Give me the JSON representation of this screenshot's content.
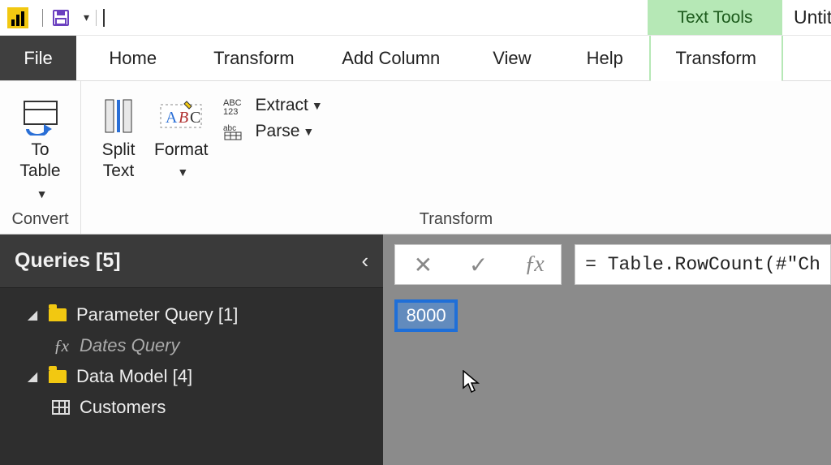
{
  "titlebar": {
    "context_tool_label": "Text Tools",
    "document_title": "Untit"
  },
  "tabs": {
    "file": "File",
    "home": "Home",
    "transform": "Transform",
    "add_column": "Add Column",
    "view": "View",
    "help": "Help",
    "context_transform": "Transform"
  },
  "ribbon": {
    "convert": {
      "to_table_line1": "To",
      "to_table_line2": "Table",
      "group_label": "Convert"
    },
    "transform": {
      "split_text_line1": "Split",
      "split_text_line2": "Text",
      "format_line1": "Format",
      "extract_label": "Extract",
      "parse_label": "Parse",
      "group_label": "Transform"
    }
  },
  "queries": {
    "header": "Queries [5]",
    "items": [
      {
        "label": "Parameter Query [1]"
      },
      {
        "label": "Dates Query"
      },
      {
        "label": "Data Model [4]"
      },
      {
        "label": "Customers"
      }
    ]
  },
  "formula_bar": {
    "text": "= Table.RowCount(#\"Ch"
  },
  "result": {
    "value": "8000"
  }
}
